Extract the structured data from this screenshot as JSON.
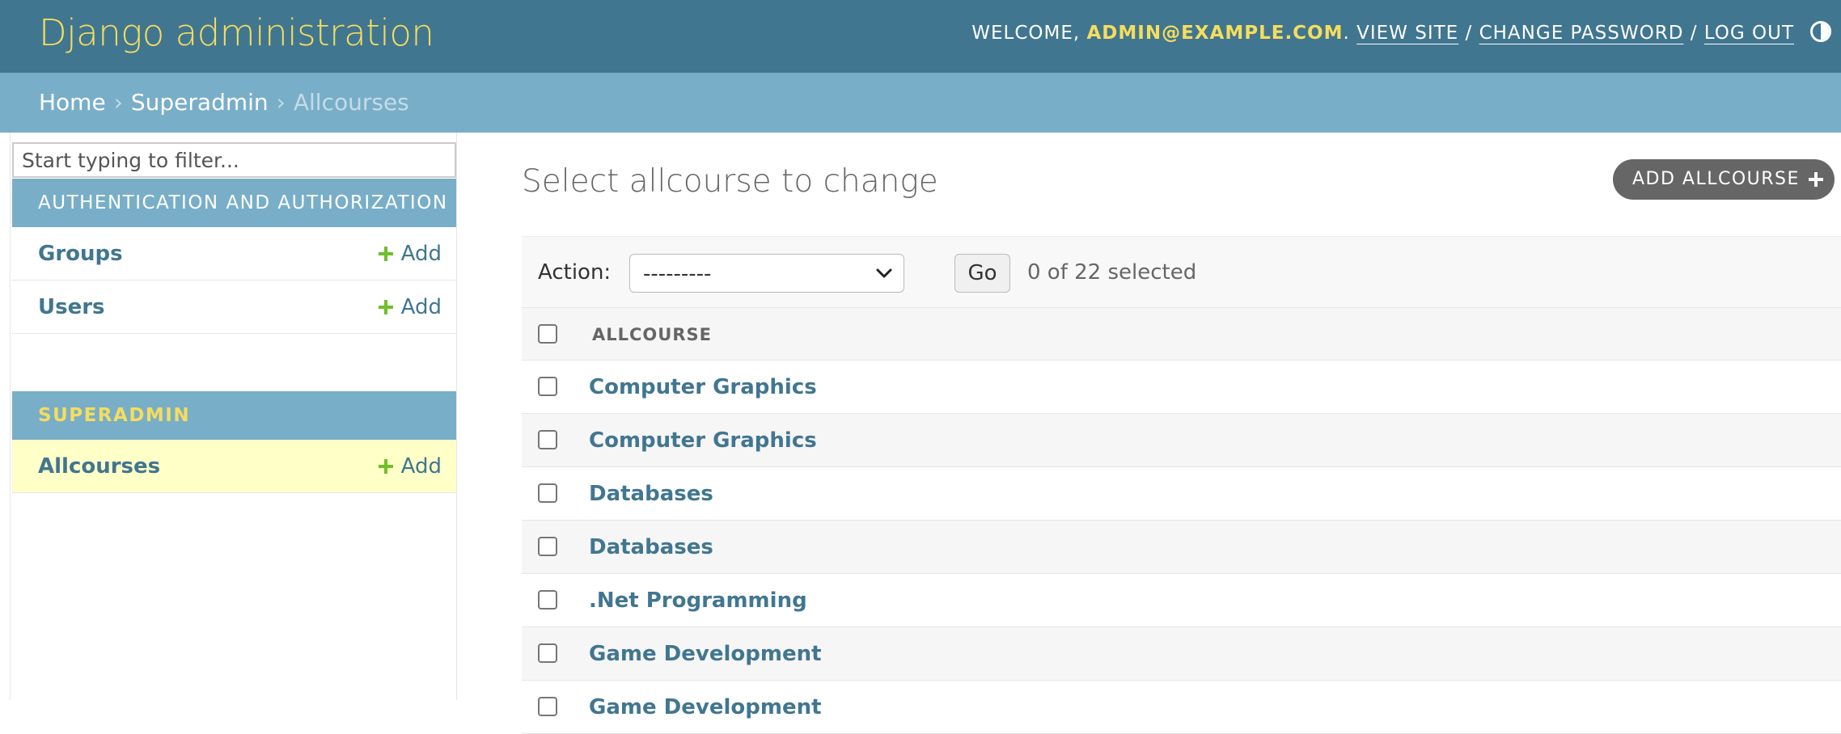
{
  "header": {
    "branding": "Django administration",
    "welcome_prefix": "WELCOME, ",
    "username": "ADMIN@EXAMPLE.COM",
    "welcome_suffix": ".",
    "view_site": "VIEW SITE",
    "change_password": "CHANGE PASSWORD",
    "log_out": "LOG OUT",
    "separator": "/",
    "theme_toggle_icon": "half-circle-contrast-icon"
  },
  "breadcrumbs": {
    "home": "Home",
    "app": "Superadmin",
    "current": "Allcourses",
    "separator": "›"
  },
  "sidebar": {
    "filter_placeholder": "Start typing to filter...",
    "modules": [
      {
        "caption": "Authentication and Authorization",
        "models": [
          {
            "name": "Groups",
            "add_label": "Add"
          },
          {
            "name": "Users",
            "add_label": "Add"
          }
        ]
      },
      {
        "caption": "Superadmin",
        "models": [
          {
            "name": "Allcourses",
            "add_label": "Add"
          }
        ]
      }
    ]
  },
  "content": {
    "title": "Select allcourse to change",
    "add_button": "ADD ALLCOURSE",
    "action_label": "Action:",
    "action_selected": "---------",
    "go_button": "Go",
    "selected_count": "0 of 22 selected",
    "column_header": "ALLCOURSE",
    "rows": [
      "Computer Graphics",
      "Computer Graphics",
      "Databases",
      "Databases",
      ".Net Programming",
      "Game Development",
      "Game Development"
    ]
  },
  "colors": {
    "header_bg": "#417690",
    "branding": "#f5dd5d",
    "breadcrumbs_bg": "#79aec8",
    "link": "#417690",
    "add_plus": "#70bf2b",
    "current_row_bg": "#ffffc8"
  }
}
